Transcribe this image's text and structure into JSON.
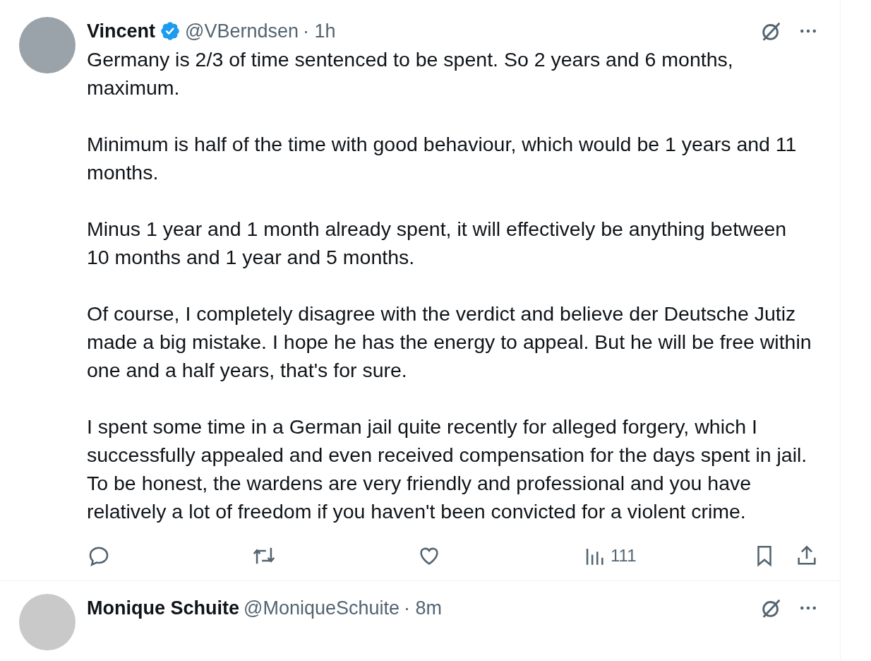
{
  "tweets": [
    {
      "author": "Vincent",
      "verified": true,
      "handle": "@VBerndsen",
      "time": "· 1h",
      "paragraphs": [
        "Germany is 2/3 of time sentenced to be spent. So 2 years and 6 months, maximum.",
        "Minimum is half of the time with good behaviour, which would be 1 years and 11 months.",
        "Minus 1 year and 1 month already spent, it will effectively be anything between 10 months and 1 year and 5 months.",
        "Of course, I completely disagree with the verdict and believe der Deutsche Jutiz made a big mistake. I hope he has the energy to appeal. But he will be free within one and a half years, that's for sure.",
        "I spent some time in a German jail quite recently for alleged forgery, which I successfully appealed and even received compensation for the days spent in jail. To be honest, the wardens are very friendly and professional and you have relatively a lot of freedom if you haven't been convicted for a violent crime."
      ],
      "actions": [
        {
          "kind": "reply"
        },
        {
          "kind": "repost"
        },
        {
          "kind": "like"
        },
        {
          "kind": "views",
          "count": "111"
        },
        {
          "kind": "bookmark"
        },
        {
          "kind": "share"
        }
      ]
    },
    {
      "author": "Monique Schuite",
      "verified": false,
      "handle": "@MoniqueSchuite",
      "time": "· 8m"
    }
  ]
}
